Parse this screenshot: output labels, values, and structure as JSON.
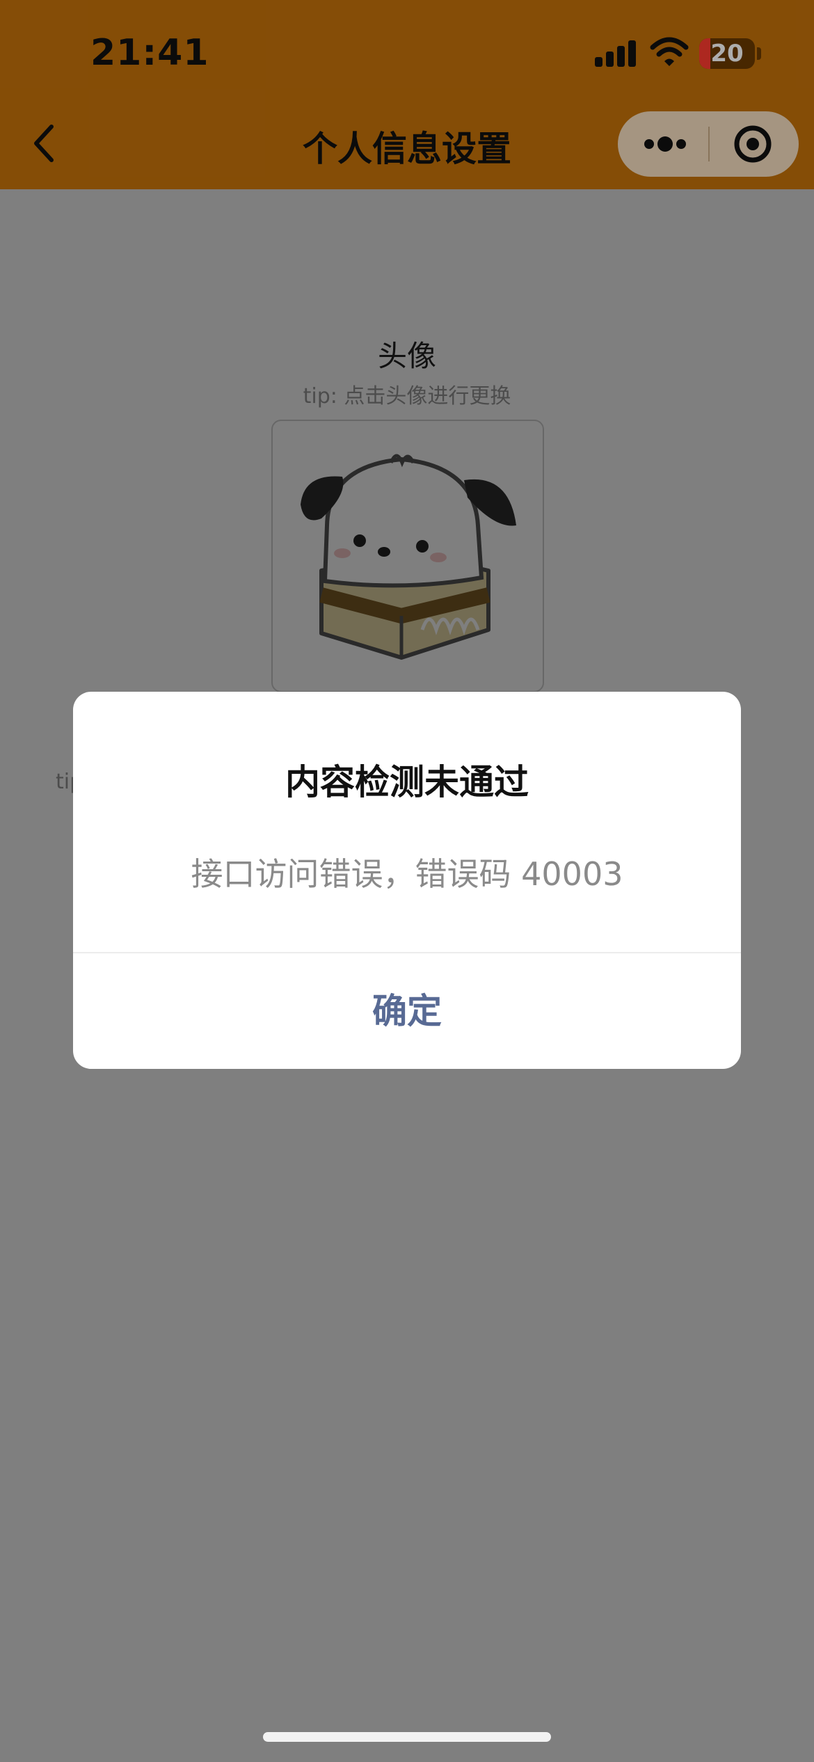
{
  "status_bar": {
    "time": "21:41",
    "battery_level": "20",
    "icons": [
      "signal-icon",
      "wifi-icon",
      "battery-icon"
    ]
  },
  "nav": {
    "title": "个人信息设置",
    "back_icon": "chevron-left-icon",
    "capsule_icons": [
      "more-dots-icon",
      "close-target-icon"
    ]
  },
  "profile": {
    "avatar_label": "头像",
    "avatar_tip": "tip: 点击头像进行更换",
    "nickname_tip_visible": "tip",
    "right_edge_mark": "("
  },
  "dialog": {
    "title": "内容检测未通过",
    "message": "接口访问错误，错误码 40003",
    "confirm_label": "确定"
  },
  "colors": {
    "header": "#c4720a",
    "dialog_confirm": "#586a94"
  }
}
